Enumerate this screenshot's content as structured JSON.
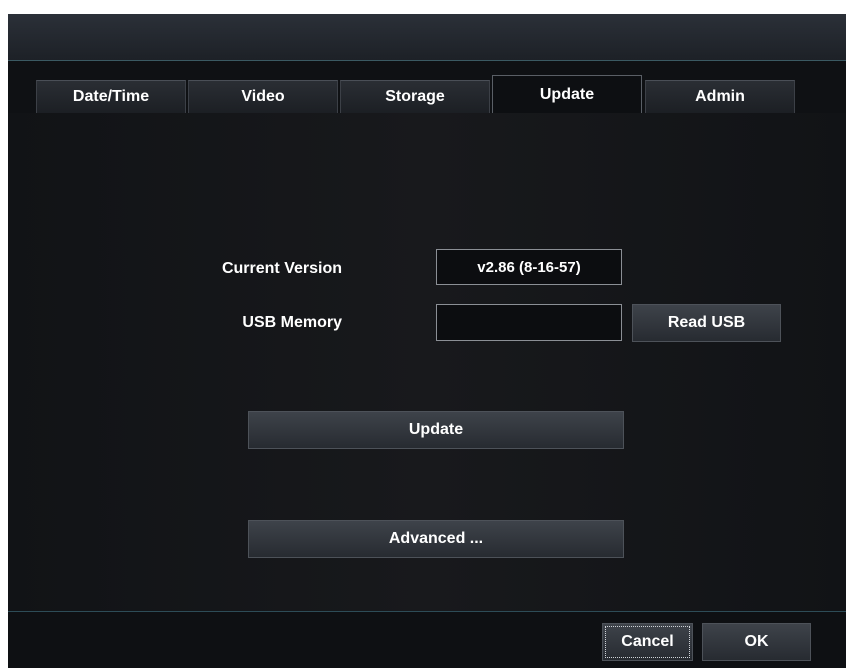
{
  "tabs": [
    {
      "label": "Date/Time",
      "active": false
    },
    {
      "label": "Video",
      "active": false
    },
    {
      "label": "Storage",
      "active": false
    },
    {
      "label": "Update",
      "active": true
    },
    {
      "label": "Admin",
      "active": false
    }
  ],
  "update": {
    "current_version_label": "Current Version",
    "current_version_value": "v2.86 (8-16-57)",
    "usb_memory_label": "USB Memory",
    "usb_memory_value": "",
    "read_usb_label": "Read USB",
    "update_label": "Update",
    "advanced_label": "Advanced ..."
  },
  "footer": {
    "cancel_label": "Cancel",
    "ok_label": "OK"
  },
  "colors": {
    "background": "#0b0c0e",
    "accent_line": "#3b5a63",
    "text": "#ffffff"
  }
}
